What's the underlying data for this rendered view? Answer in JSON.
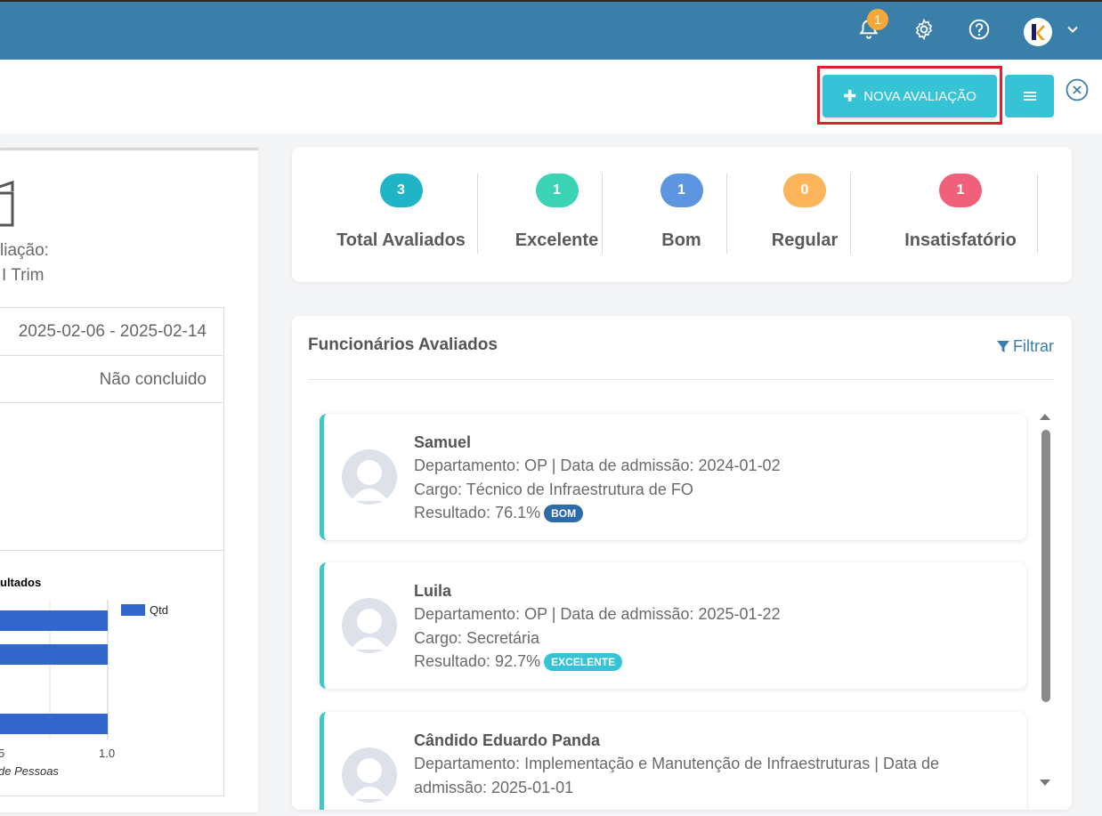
{
  "header": {
    "notification_count": "1",
    "icons": [
      "bell-icon",
      "gear-icon",
      "help-icon",
      "user-avatar",
      "chevron-down-icon"
    ]
  },
  "toolbar": {
    "new_evaluation_label": "NOVA AVALIAÇÃO"
  },
  "left_panel": {
    "label_partial": "liação:",
    "period_partial": "I Trim",
    "date_range": "2025-02-06 - 2025-02-14",
    "status": "Não concluido"
  },
  "chart_data": {
    "type": "bar",
    "orientation": "horizontal",
    "title": "ultados",
    "xlabel": "de Pessoas",
    "x_tick_labels": [
      "5",
      "1.0"
    ],
    "xlim": [
      0,
      1.0
    ],
    "legend": "Qtd",
    "series": [
      {
        "name": "Qtd",
        "values": [
          1,
          1,
          1
        ]
      }
    ],
    "colors": {
      "bar": "#3366cc"
    }
  },
  "stats": [
    {
      "count": "3",
      "label": "Total Avaliados",
      "color": "#1fb5c7"
    },
    {
      "count": "1",
      "label": "Excelente",
      "color": "#3bd3b5"
    },
    {
      "count": "1",
      "label": "Bom",
      "color": "#5d95e0"
    },
    {
      "count": "0",
      "label": "Regular",
      "color": "#fcb55a"
    },
    {
      "count": "1",
      "label": "Insatisfatório",
      "color": "#f0607a"
    }
  ],
  "employees": {
    "title": "Funcionários Avaliados",
    "filter_label": "Filtrar",
    "items": [
      {
        "name": "Samuel",
        "department": "Departamento: OP | Data de admissão: 2024-01-02",
        "role": "Cargo: Técnico de Infraestrutura de FO",
        "result": "Resultado: 76.1%",
        "tag": "BOM",
        "tag_color": "#2f6aa8"
      },
      {
        "name": "Luila",
        "department": "Departamento: OP | Data de admissão: 2025-01-22",
        "role": "Cargo: Secretária",
        "result": "Resultado: 92.7%",
        "tag": "EXCELENTE",
        "tag_color": "#36c3d6"
      },
      {
        "name": "Cândido Eduardo Panda",
        "department_line1": "Departamento: Implementação e Manutenção de Infraestruturas | Data de",
        "department_line2": "admissão: 2025-01-01"
      }
    ]
  }
}
